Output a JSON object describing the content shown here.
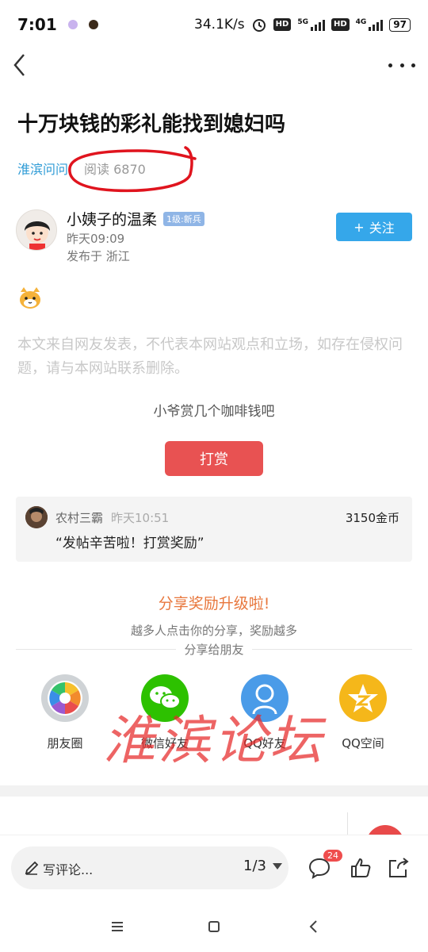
{
  "status": {
    "time": "7:01",
    "speed": "34.1K/s",
    "net1": "5G",
    "net2": "4G",
    "hd": "HD",
    "battery": "97"
  },
  "article": {
    "title": "十万块钱的彩礼能找到媳妇吗",
    "channel": "淮滨问问",
    "read_label": "阅读 6870"
  },
  "author": {
    "name": "小姨子的温柔",
    "level": "1级:新兵",
    "time": "昨天09:09",
    "location": "发布于 浙江",
    "follow_label": "关注",
    "follow_plus": "+"
  },
  "body": {
    "disclaimer": "本文来自网友发表，不代表本网站观点和立场，如存在侵权问题，请与本网站联系删除。"
  },
  "reward": {
    "hint": "小爷赏几个咖啡钱吧",
    "button_label": "打赏",
    "record": {
      "user": "农村三霸",
      "time": "昨天10:51",
      "coins": "3150金币",
      "message": "“发帖辛苦啦！打赏奖励”"
    }
  },
  "share": {
    "title": "分享奖励升级啦!",
    "subtitle": "越多人点击你的分享，奖励越多",
    "share_to": "分享给朋友",
    "items": [
      {
        "label": "朋友圈",
        "icon": "moments-icon",
        "color": "#cfd3d6"
      },
      {
        "label": "微信好友",
        "icon": "wechat-icon",
        "color": "#2dc100"
      },
      {
        "label": "QQ好友",
        "icon": "qq-icon",
        "color": "#4a9be8"
      },
      {
        "label": "QQ空间",
        "icon": "qzone-icon",
        "color": "#f5b71a"
      }
    ]
  },
  "watermark": "淮滨论坛",
  "bottom": {
    "comment_placeholder": "写评论...",
    "page_indicator": "1/3",
    "comment_count": "24"
  }
}
